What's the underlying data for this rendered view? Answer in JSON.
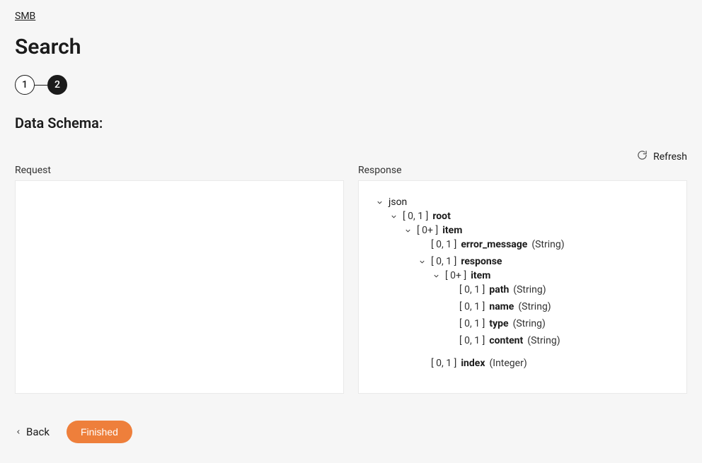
{
  "breadcrumb": {
    "label": "SMB"
  },
  "page": {
    "title": "Search"
  },
  "stepper": {
    "steps": [
      "1",
      "2"
    ],
    "activeIndex": 1
  },
  "section": {
    "title": "Data Schema:"
  },
  "refresh": {
    "label": "Refresh"
  },
  "panels": {
    "request": {
      "label": "Request"
    },
    "response": {
      "label": "Response"
    }
  },
  "tree": {
    "root": {
      "label": "json",
      "children": [
        {
          "card": "[ 0, 1 ]",
          "name": "root",
          "children": [
            {
              "card": "[ 0+ ]",
              "name": "item",
              "children": [
                {
                  "card": "[ 0, 1 ]",
                  "name": "error_message",
                  "type": "(String)"
                },
                {
                  "card": "[ 0, 1 ]",
                  "name": "response",
                  "children": [
                    {
                      "card": "[ 0+ ]",
                      "name": "item",
                      "children": [
                        {
                          "card": "[ 0, 1 ]",
                          "name": "path",
                          "type": "(String)"
                        },
                        {
                          "card": "[ 0, 1 ]",
                          "name": "name",
                          "type": "(String)"
                        },
                        {
                          "card": "[ 0, 1 ]",
                          "name": "type",
                          "type": "(String)"
                        },
                        {
                          "card": "[ 0, 1 ]",
                          "name": "content",
                          "type": "(String)"
                        }
                      ]
                    }
                  ]
                },
                {
                  "card": "[ 0, 1 ]",
                  "name": "index",
                  "type": "(Integer)"
                }
              ]
            }
          ]
        }
      ]
    }
  },
  "footer": {
    "back": "Back",
    "finished": "Finished"
  }
}
